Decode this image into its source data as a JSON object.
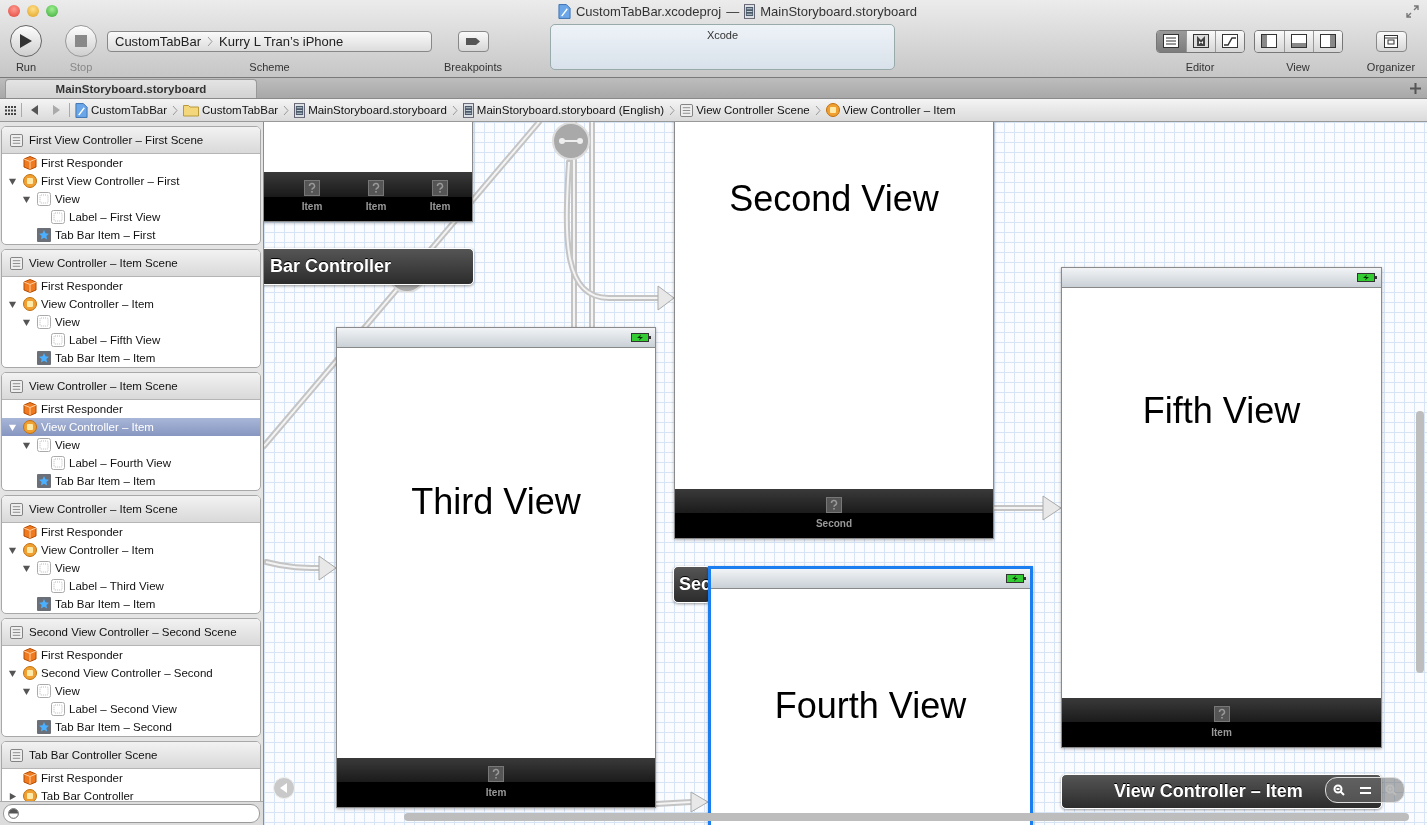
{
  "window": {
    "title_parts": [
      {
        "kind": "project",
        "text": "CustomTabBar.xcodeproj"
      },
      {
        "kind": "separator",
        "text": "—"
      },
      {
        "kind": "storyboard",
        "text": "MainStoryboard.storyboard"
      }
    ]
  },
  "toolbar": {
    "run": "Run",
    "stop": "Stop",
    "scheme": {
      "target": "CustomTabBar",
      "device": "Kurry L Tran’s iPhone",
      "label": "Scheme"
    },
    "breakpoints": "Breakpoints",
    "activity": "Xcode",
    "editor": {
      "label": "Editor",
      "segments": [
        {
          "kind": "standard",
          "selected": true
        },
        {
          "kind": "assistant",
          "selected": false
        },
        {
          "kind": "version",
          "selected": false
        }
      ]
    },
    "view": {
      "label": "View",
      "segments": [
        {
          "kind": "left",
          "selected": false
        },
        {
          "kind": "bottom",
          "selected": false
        },
        {
          "kind": "right",
          "selected": false
        }
      ]
    },
    "organizer": "Organizer"
  },
  "tabs": [
    {
      "label": "MainStoryboard.storyboard",
      "selected": true
    }
  ],
  "jump_bar": [
    {
      "kind": "project",
      "text": "CustomTabBar"
    },
    {
      "kind": "folder",
      "text": "CustomTabBar"
    },
    {
      "kind": "storyboard",
      "text": "MainStoryboard.storyboard"
    },
    {
      "kind": "storyboard",
      "text": "MainStoryboard.storyboard (English)"
    },
    {
      "kind": "scene",
      "text": "View Controller Scene"
    },
    {
      "kind": "controller",
      "text": "View Controller – Item"
    }
  ],
  "outline": {
    "scenes": [
      {
        "title": "First View Controller – First Scene",
        "items": [
          {
            "kind": "responder",
            "label": "First Responder",
            "selected": false
          },
          {
            "kind": "controller",
            "label": "First View Controller – First",
            "expanded": true,
            "selected": false,
            "children": [
              {
                "kind": "view",
                "label": "View",
                "expanded": true,
                "selected": false,
                "children": [
                  {
                    "kind": "label",
                    "label": "Label – First View",
                    "selected": false
                  }
                ]
              },
              {
                "kind": "tabitem",
                "label": "Tab Bar Item – First",
                "selected": false
              }
            ]
          }
        ]
      },
      {
        "title": "View Controller – Item Scene",
        "items": [
          {
            "kind": "responder",
            "label": "First Responder",
            "selected": false
          },
          {
            "kind": "controller",
            "label": "View Controller – Item",
            "expanded": true,
            "selected": false,
            "children": [
              {
                "kind": "view",
                "label": "View",
                "expanded": true,
                "selected": false,
                "children": [
                  {
                    "kind": "label",
                    "label": "Label – Fifth View",
                    "selected": false
                  }
                ]
              },
              {
                "kind": "tabitem",
                "label": "Tab Bar Item – Item",
                "selected": false
              }
            ]
          }
        ]
      },
      {
        "title": "View Controller – Item Scene",
        "items": [
          {
            "kind": "responder",
            "label": "First Responder",
            "selected": false
          },
          {
            "kind": "controller",
            "label": "View Controller – Item",
            "expanded": true,
            "selected": true,
            "children": [
              {
                "kind": "view",
                "label": "View",
                "expanded": true,
                "selected": false,
                "children": [
                  {
                    "kind": "label",
                    "label": "Label – Fourth View",
                    "selected": false
                  }
                ]
              },
              {
                "kind": "tabitem",
                "label": "Tab Bar Item – Item",
                "selected": false
              }
            ]
          }
        ]
      },
      {
        "title": "View Controller – Item Scene",
        "items": [
          {
            "kind": "responder",
            "label": "First Responder",
            "selected": false
          },
          {
            "kind": "controller",
            "label": "View Controller – Item",
            "expanded": true,
            "selected": false,
            "children": [
              {
                "kind": "view",
                "label": "View",
                "expanded": true,
                "selected": false,
                "children": [
                  {
                    "kind": "label",
                    "label": "Label – Third View",
                    "selected": false
                  }
                ]
              },
              {
                "kind": "tabitem",
                "label": "Tab Bar Item – Item",
                "selected": false
              }
            ]
          }
        ]
      },
      {
        "title": "Second View Controller – Second Scene",
        "items": [
          {
            "kind": "responder",
            "label": "First Responder",
            "selected": false
          },
          {
            "kind": "controller",
            "label": "Second View Controller – Second",
            "expanded": true,
            "selected": false,
            "children": [
              {
                "kind": "view",
                "label": "View",
                "expanded": true,
                "selected": false,
                "children": [
                  {
                    "kind": "label",
                    "label": "Label – Second View",
                    "selected": false
                  }
                ]
              },
              {
                "kind": "tabitem",
                "label": "Tab Bar Item – Second",
                "selected": false
              }
            ]
          }
        ]
      },
      {
        "title": "Tab Bar Controller Scene",
        "items": [
          {
            "kind": "responder",
            "label": "First Responder",
            "selected": false
          },
          {
            "kind": "controller",
            "label": "Tab Bar Controller",
            "expanded": false,
            "selected": false
          }
        ]
      }
    ]
  },
  "canvas": {
    "items": [
      {
        "kind": "view",
        "status_bar": false,
        "selected": false,
        "tab_items": [
          "Item",
          "Item",
          "Item"
        ]
      },
      {
        "kind": "label_bar",
        "text": "Bar Controller"
      },
      {
        "kind": "view",
        "title": "Second View",
        "status_bar": false,
        "selected": false,
        "tab_items": [
          "Second"
        ]
      },
      {
        "kind": "view",
        "title": "Fifth View",
        "status_bar": true,
        "selected": false,
        "tab_items": [
          "Item"
        ]
      },
      {
        "kind": "view",
        "title": "Third View",
        "status_bar": true,
        "selected": false,
        "tab_items": [
          "Item"
        ]
      },
      {
        "kind": "label_bar",
        "text": "Sec"
      },
      {
        "kind": "view",
        "title": "Fourth View",
        "status_bar": true,
        "selected": true
      },
      {
        "kind": "label_bar",
        "text": "View Controller – Item"
      }
    ]
  }
}
